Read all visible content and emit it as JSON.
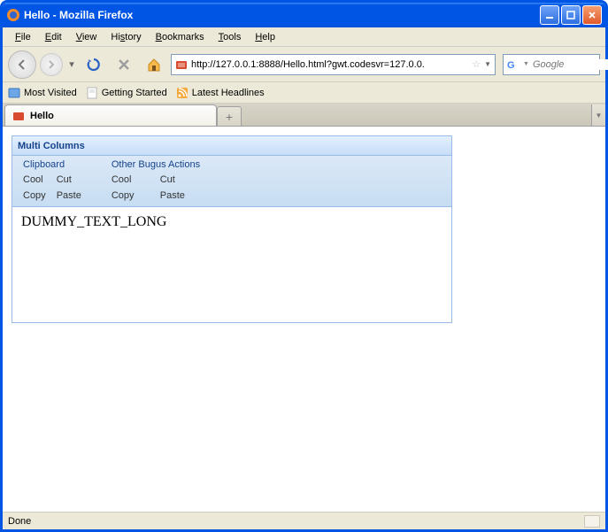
{
  "window": {
    "title": "Hello - Mozilla Firefox"
  },
  "menubar": {
    "file": "File",
    "edit": "Edit",
    "view": "View",
    "history": "History",
    "bookmarks": "Bookmarks",
    "tools": "Tools",
    "help": "Help"
  },
  "url": "http://127.0.0.1:8888/Hello.html?gwt.codesvr=127.0.0.",
  "search": {
    "placeholder": "Google"
  },
  "bookmarks": {
    "most_visited": "Most Visited",
    "getting_started": "Getting Started",
    "latest_headlines": "Latest Headlines"
  },
  "tabs": {
    "active": "Hello",
    "new": "+"
  },
  "panel": {
    "title": "Multi Columns",
    "groups": [
      {
        "title": "Clipboard",
        "items": [
          "Cool",
          "Cut",
          "Copy",
          "Paste"
        ]
      },
      {
        "title": "Other Bugus Actions",
        "items": [
          "Cool",
          "Cut",
          "Copy",
          "Paste"
        ]
      }
    ],
    "body": "DUMMY_TEXT_LONG"
  },
  "status": "Done"
}
